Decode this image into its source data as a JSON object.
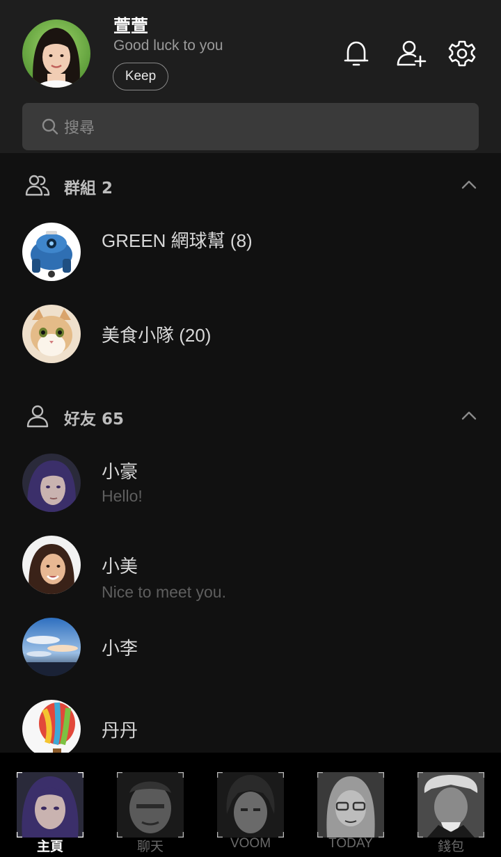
{
  "profile": {
    "name": "萱萱",
    "status": "Good luck to you",
    "keep_label": "Keep",
    "icons": [
      "bell-icon",
      "add-friend-icon",
      "settings-gear-icon"
    ]
  },
  "search": {
    "placeholder": "搜尋"
  },
  "groups": {
    "title": "群組 2",
    "items": [
      {
        "name": "GREEN 網球幫 (8)"
      },
      {
        "name": "美食小隊 (20)"
      }
    ]
  },
  "friends": {
    "title": "好友 65",
    "items": [
      {
        "name": "小豪",
        "status": "Hello!"
      },
      {
        "name": "小美",
        "status": "Nice to meet you."
      },
      {
        "name": "小李"
      },
      {
        "name": "丹丹"
      }
    ]
  },
  "tabs": [
    {
      "label": "主頁",
      "active": true
    },
    {
      "label": "聊天"
    },
    {
      "label": "VOOM"
    },
    {
      "label": "TODAY"
    },
    {
      "label": "錢包"
    }
  ],
  "colors": {
    "background": "#111111",
    "header": "#1e1e1e",
    "search_box": "#3a3a3a",
    "tabbar": "#000000"
  }
}
